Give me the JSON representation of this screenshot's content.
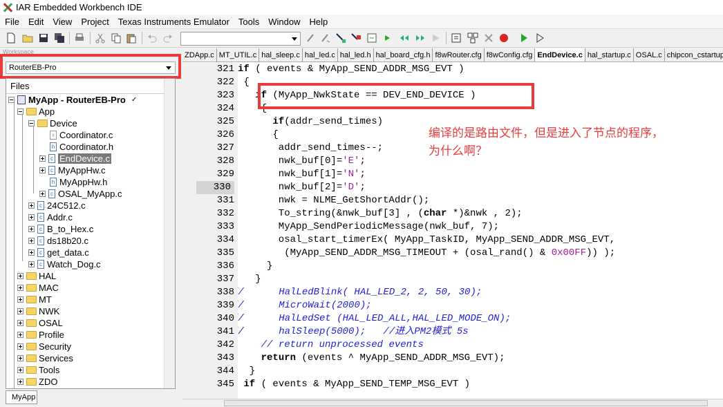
{
  "window": {
    "title": "IAR Embedded Workbench IDE"
  },
  "menu": [
    "File",
    "Edit",
    "View",
    "Project",
    "Texas Instruments Emulator",
    "Tools",
    "Window",
    "Help"
  ],
  "workspace": {
    "label": "Workspace",
    "config": "RouterEB-Pro",
    "files_header": "Files",
    "bottom_tab": "MyApp"
  },
  "tree": [
    {
      "label": "MyApp - RouterEB-Pro",
      "kind": "project"
    },
    {
      "label": "App",
      "kind": "folder"
    },
    {
      "label": "Device",
      "kind": "folder"
    },
    {
      "label": "Coordinator.c",
      "kind": "file-excluded"
    },
    {
      "label": "Coordinator.h",
      "kind": "file"
    },
    {
      "label": "EndDevice.c",
      "kind": "file",
      "selected": true
    },
    {
      "label": "MyAppHw.c",
      "kind": "file"
    },
    {
      "label": "MyAppHw.h",
      "kind": "file"
    },
    {
      "label": "OSAL_MyApp.c",
      "kind": "file"
    },
    {
      "label": "24C512.c",
      "kind": "file"
    },
    {
      "label": "Addr.c",
      "kind": "file"
    },
    {
      "label": "B_to_Hex.c",
      "kind": "file"
    },
    {
      "label": "ds18b20.c",
      "kind": "file"
    },
    {
      "label": "get_data.c",
      "kind": "file"
    },
    {
      "label": "Watch_Dog.c",
      "kind": "file"
    },
    {
      "label": "HAL",
      "kind": "folder"
    },
    {
      "label": "MAC",
      "kind": "folder"
    },
    {
      "label": "MT",
      "kind": "folder"
    },
    {
      "label": "NWK",
      "kind": "folder"
    },
    {
      "label": "OSAL",
      "kind": "folder"
    },
    {
      "label": "Profile",
      "kind": "folder"
    },
    {
      "label": "Security",
      "kind": "folder"
    },
    {
      "label": "Services",
      "kind": "folder"
    },
    {
      "label": "Tools",
      "kind": "folder"
    },
    {
      "label": "ZDO",
      "kind": "folder"
    }
  ],
  "tabs": [
    "ZDApp.c",
    "MT_UTIL.c",
    "hal_sleep.c",
    "hal_led.c",
    "hal_led.h",
    "hal_board_cfg.h",
    "f8wRouter.cfg",
    "f8wConfig.cfg",
    "EndDevice.c",
    "hal_startup.c",
    "OSAL.c",
    "chipcon_cstartup"
  ],
  "active_tab": "EndDevice.c",
  "current_line": "330",
  "line_numbers": [
    "321",
    "322",
    "323",
    "324",
    "325",
    "326",
    "327",
    "328",
    "329",
    "330",
    "331",
    "332",
    "333",
    "334",
    "335",
    "336",
    "337",
    "338",
    "339",
    "340",
    "341",
    "342",
    "343",
    "344",
    "345"
  ],
  "code_lines": [
    "if ( events & MyApp_SEND_ADDR_MSG_EVT )",
    " {",
    "   if (MyApp_NwkState == DEV_END_DEVICE )",
    "    {",
    "      if(addr_send_times)",
    "      {",
    "       addr_send_times--;",
    "       nwk_buf[0]='E';",
    "       nwk_buf[1]='N';",
    "       nwk_buf[2]='D';",
    "       nwk = NLME_GetShortAddr();",
    "       To_string(&nwk_buf[3] , (char *)&nwk , 2);",
    "       MyApp_SendPeriodicMessage(nwk_buf, 7);",
    "       osal_start_timerEx( MyApp_TaskID, MyApp_SEND_ADDR_MSG_EVT,",
    "        (MyApp_SEND_ADDR_MSG_TIMEOUT + (osal_rand() & 0x00FF)) );",
    "     }",
    "   }",
    "//      HalLedBlink( HAL_LED_2, 2, 50, 30);",
    "//      MicroWait(2000);",
    "//      HalLedSet (HAL_LED_ALL,HAL_LED_MODE_ON);",
    "//      halSleep(5000);   //进入PM2模式 5s",
    "    // return unprocessed events",
    "    return (events ^ MyApp_SEND_ADDR_MSG_EVT);",
    "  }",
    " if ( events & MyApp_SEND_TEMP_MSG_EVT )"
  ],
  "annotation": "编译的是路由文件，但是进入了节点的程序，\n为什么啊？",
  "colors": {
    "highlight_red": "#e83c3c",
    "comment": "#1f1fd8",
    "char_literal": "#a020a0"
  }
}
